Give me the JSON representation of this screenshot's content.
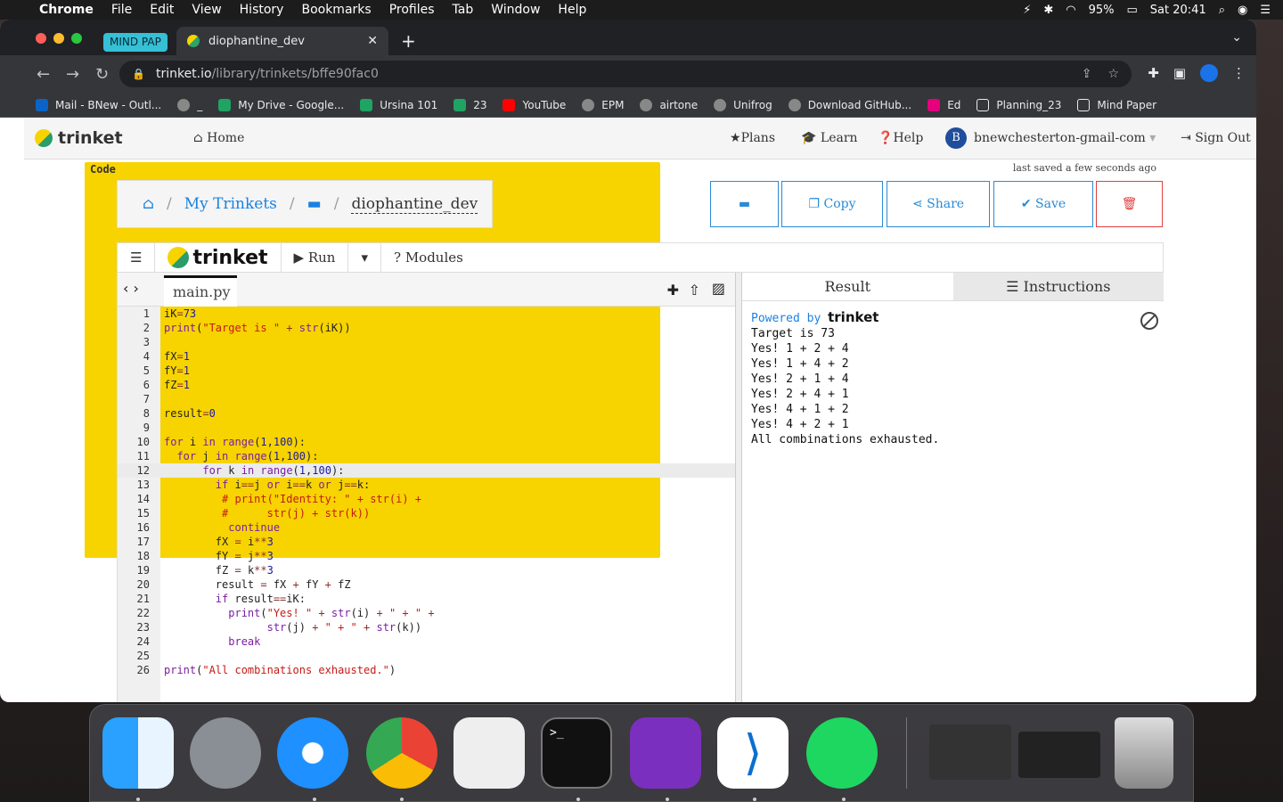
{
  "menubar": {
    "app": "Chrome",
    "items": [
      "File",
      "Edit",
      "View",
      "History",
      "Bookmarks",
      "Profiles",
      "Tab",
      "Window",
      "Help"
    ],
    "battery": "95%",
    "clock": "Sat 20:41"
  },
  "browser": {
    "group_tag": "MIND PAP",
    "tab_title": "diophantine_dev",
    "url_host": "trinket.io",
    "url_path": "/library/trinkets/bffe90fac0",
    "bookmarks": [
      "Mail - BNew - Outl...",
      "_",
      "My Drive - Google...",
      "Ursina 101",
      "23",
      "YouTube",
      "EPM",
      "airtone",
      "Unifrog",
      "Download GitHub...",
      "Ed",
      "Planning_23",
      "Mind Paper"
    ]
  },
  "trinket_nav": {
    "logo": "trinket",
    "logo_tag": "Code",
    "home": "Home",
    "plans": "Plans",
    "learn": "Learn",
    "help": "Help",
    "avatar_letter": "B",
    "user": "bnewchesterton-gmail-com",
    "signout": "Sign Out",
    "last_saved": "last saved a few seconds ago"
  },
  "breadcrumb": {
    "my_trinkets": "My Trinkets",
    "current": "diophantine_dev"
  },
  "actions": {
    "copy": "Copy",
    "share": "Share",
    "save": "Save"
  },
  "editor": {
    "brand": "trinket",
    "run": "Run",
    "modules": "Modules",
    "file_tab": "main.py",
    "lines": [
      "1",
      "2",
      "3",
      "4",
      "5",
      "6",
      "7",
      "8",
      "9",
      "10",
      "11",
      "12",
      "13",
      "14",
      "15",
      "16",
      "17",
      "18",
      "19",
      "20",
      "21",
      "22",
      "23",
      "24",
      "25",
      "26"
    ]
  },
  "result": {
    "tab_result": "Result",
    "tab_instructions": "Instructions",
    "powered_by": "Powered by",
    "powered_brand": "trinket",
    "output": "Target is 73\nYes! 1 + 2 + 4\nYes! 1 + 4 + 2\nYes! 2 + 1 + 4\nYes! 2 + 4 + 1\nYes! 4 + 1 + 2\nYes! 4 + 2 + 1\nAll combinations exhausted."
  },
  "dock": [
    "Finder",
    "Launchpad",
    "Safari",
    "Chrome",
    "Unity Hub",
    "Terminal",
    "GitHub Desktop",
    "Visual Studio Code",
    "Spotify",
    "Trash"
  ]
}
